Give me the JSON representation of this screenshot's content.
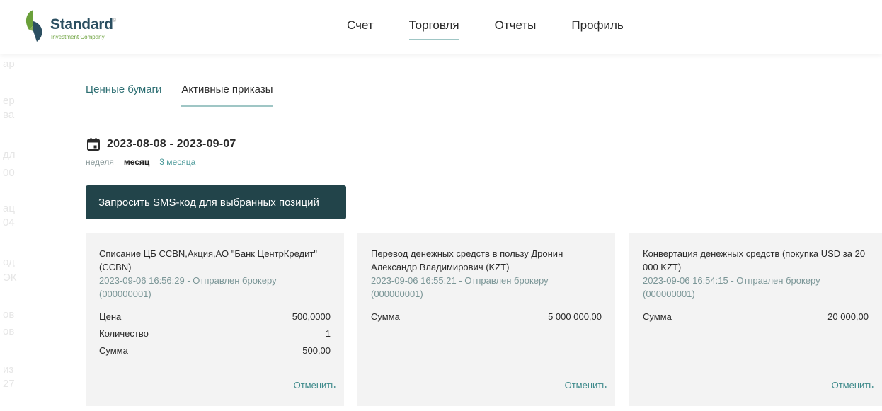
{
  "brand": {
    "name": "Standard",
    "tagline": "Investment Company",
    "registered": "®",
    "colors": {
      "primary": "#2b4f61",
      "green": "#6aa03a",
      "button": "#22444a",
      "accent": "#9fc6c5"
    }
  },
  "nav": {
    "items": [
      {
        "label": "Счет"
      },
      {
        "label": "Торговля",
        "active": true
      },
      {
        "label": "Отчеты"
      },
      {
        "label": "Профиль"
      }
    ]
  },
  "subtabs": [
    {
      "label": "Ценные бумаги"
    },
    {
      "label": "Активные приказы",
      "active": true
    }
  ],
  "filters": {
    "date_range": "2023-08-08 - 2023-09-07",
    "date_icon": "calendar-icon",
    "periods": [
      {
        "label": "неделя"
      },
      {
        "label": "месяц",
        "active": true
      },
      {
        "label": "3 месяца"
      }
    ]
  },
  "actions": {
    "sms_button_label": "Запросить SMS-код для выбранных позиций"
  },
  "orders": [
    {
      "title": "Списание ЦБ CCBN,Акция,АО \"Банк ЦентрКредит\" (CCBN)",
      "meta": "2023-09-06 16:56:29 - Отправлен брокеру (000000001)",
      "rows": [
        {
          "label": "Цена",
          "value": "500,0000"
        },
        {
          "label": "Количество",
          "value": "1"
        },
        {
          "label": "Сумма",
          "value": "500,00"
        }
      ],
      "cancel_label": "Отменить"
    },
    {
      "title": "Перевод денежных средств в пользу Дронин Александр Владимирович (KZT)",
      "meta": "2023-09-06 16:55:21 - Отправлен брокеру (000000001)",
      "rows": [
        {
          "label": "Сумма",
          "value": "5 000 000,00"
        }
      ],
      "cancel_label": "Отменить"
    },
    {
      "title": "Конвертация денежных средств (покупка USD за 20 000 KZT)",
      "meta": "2023-09-06 16:54:15 - Отправлен брокеру (000000001)",
      "rows": [
        {
          "label": "Сумма",
          "value": "20 000,00"
        }
      ],
      "cancel_label": "Отменить"
    }
  ]
}
